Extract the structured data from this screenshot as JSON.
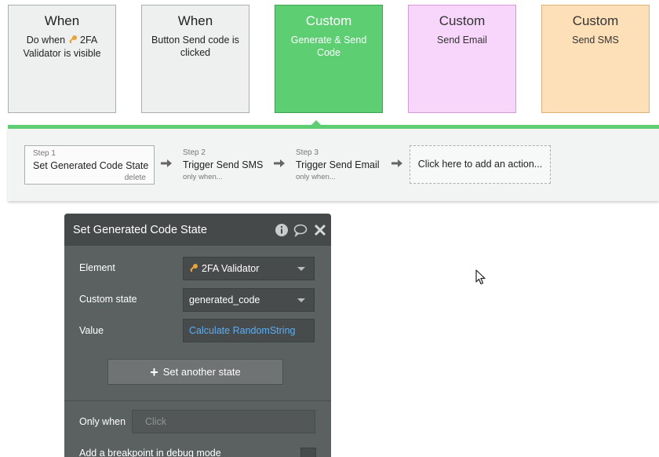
{
  "events": [
    {
      "title": "When",
      "subtitle_pre": "Do when",
      "subtitle_post": "2FA Validator is visible",
      "style": "grey"
    },
    {
      "title": "When",
      "subtitle": "Button Send code is clicked",
      "style": "grey"
    },
    {
      "title": "Custom",
      "subtitle": "Generate & Send Code",
      "style": "green"
    },
    {
      "title": "Custom",
      "subtitle": "Send Email",
      "style": "pink"
    },
    {
      "title": "Custom",
      "subtitle": "Send SMS",
      "style": "orange"
    }
  ],
  "workflow": {
    "steps": [
      {
        "label": "Step 1",
        "title": "Set Generated Code State",
        "action": "delete"
      },
      {
        "label": "Step 2",
        "title": "Trigger Send SMS",
        "condition": "only when..."
      },
      {
        "label": "Step 3",
        "title": "Trigger Send Email",
        "condition": "only when..."
      }
    ],
    "add_action": "Click here to add an action..."
  },
  "panel": {
    "title": "Set Generated Code State",
    "element_label": "Element",
    "element_value": "2FA Validator",
    "custom_state_label": "Custom state",
    "custom_state_value": "generated_code",
    "value_label": "Value",
    "value_expression": "Calculate RandomString",
    "set_another_state": "Set another state",
    "only_when_label": "Only when",
    "only_when_placeholder": "Click",
    "breakpoint_label": "Add a breakpoint in debug mode"
  },
  "colors": {
    "accent_green": "#5dce72",
    "custom_pink": "#f8d6fb",
    "custom_orange": "#fde0b8",
    "panel_bg": "#5b6061",
    "link_blue": "#5aaef5"
  }
}
